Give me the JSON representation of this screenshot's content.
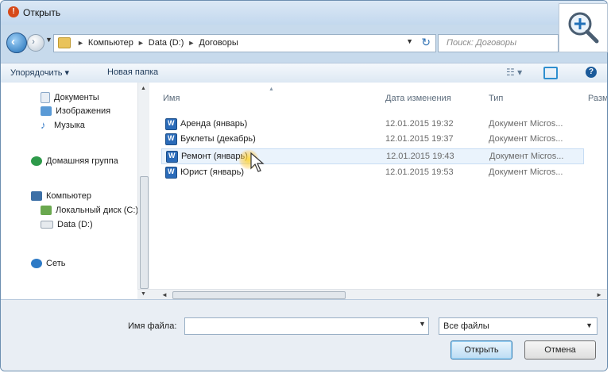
{
  "window": {
    "title": "Открыть"
  },
  "address": {
    "crumbs": [
      "Компьютер",
      "Data (D:)",
      "Договоры"
    ],
    "search_placeholder": "Поиск: Договоры"
  },
  "toolbar": {
    "organize": "Упорядочить ▾",
    "new_folder": "Новая папка"
  },
  "nav": {
    "items": [
      {
        "label": "Документы",
        "icon": "documents-icon",
        "color": "#8aa8c8"
      },
      {
        "label": "Изображения",
        "icon": "pictures-icon",
        "color": "#5a9ad6"
      },
      {
        "label": "Музыка",
        "icon": "music-icon",
        "color": "#3d7fc9"
      },
      {
        "label": "Домашняя группа",
        "icon": "homegroup-icon",
        "color": "#2e9a4a"
      },
      {
        "label": "Компьютер",
        "icon": "computer-icon",
        "color": "#3c6fa6"
      },
      {
        "label": "Локальный диск (C:)",
        "icon": "drive-c-icon",
        "color": "#6aa84f"
      },
      {
        "label": "Data (D:)",
        "icon": "drive-d-icon",
        "color": "#b8c2cc"
      },
      {
        "label": "Сеть",
        "icon": "network-icon",
        "color": "#2d7ac6"
      }
    ]
  },
  "files": {
    "columns": {
      "name": "Имя",
      "date": "Дата изменения",
      "type": "Тип",
      "size": "Размер"
    },
    "rows": [
      {
        "name": "Аренда (январь)",
        "date": "12.01.2015 19:32",
        "type": "Документ Micros..."
      },
      {
        "name": "Буклеты (декабрь)",
        "date": "12.01.2015 19:37",
        "type": "Документ Micros..."
      },
      {
        "name": "Ремонт (январь)",
        "date": "12.01.2015 19:43",
        "type": "Документ Micros...",
        "selected": true
      },
      {
        "name": "Юрист (январь)",
        "date": "12.01.2015 19:53",
        "type": "Документ Micros..."
      }
    ]
  },
  "bottom": {
    "filename_label": "Имя файла:",
    "filename_value": "",
    "filter": "Все файлы",
    "open_button": "Открыть",
    "cancel_button": "Отмена"
  },
  "colors": {
    "accent": "#3c7fb1",
    "selection": "#eaf3fc",
    "doc_icon": "#2a6bb9"
  }
}
